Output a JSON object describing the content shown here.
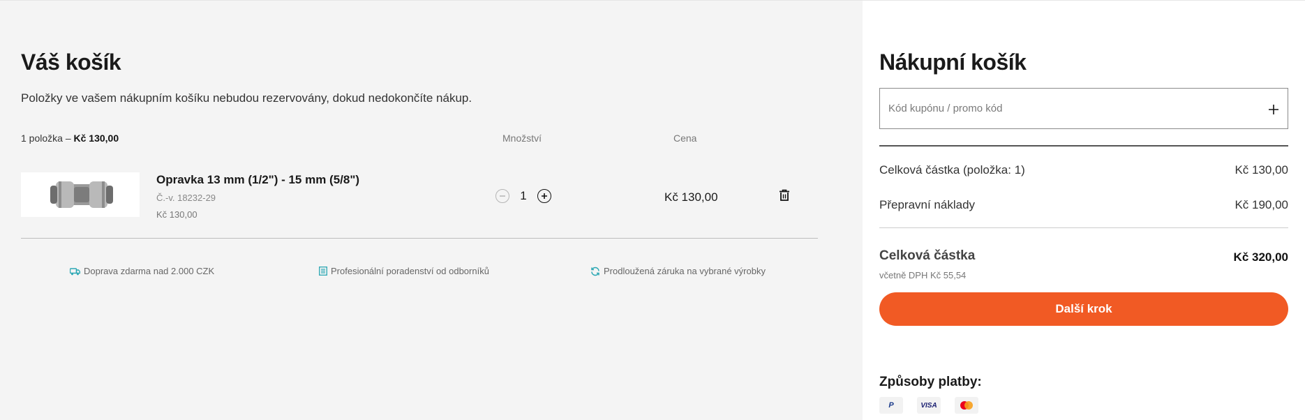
{
  "cart": {
    "title": "Váš košík",
    "note": "Položky ve vašem nákupním košíku nebudou rezervovány, dokud nedokončíte nákup.",
    "summary_prefix": "1 položka – ",
    "summary_total": "Kč 130,00",
    "col_quantity": "Množství",
    "col_price": "Cena"
  },
  "item": {
    "name": "Opravka 13 mm (1/2\") - 15 mm (5/8\")",
    "sku": "Č.-v. 18232-29",
    "unit_price": "Kč 130,00",
    "quantity": "1",
    "line_price": "Kč 130,00",
    "image_icon": "hose-connector-image",
    "delete_icon": "trash-icon"
  },
  "perks": [
    {
      "icon": "truck-icon",
      "label": "Doprava zdarma nad 2.000 CZK"
    },
    {
      "icon": "list-icon",
      "label": "Profesionální poradenství od odborníků"
    },
    {
      "icon": "refresh-icon",
      "label": "Prodloužená záruka na vybrané výrobky"
    }
  ],
  "summary": {
    "title": "Nákupní košík",
    "coupon_placeholder": "Kód kupónu / promo kód",
    "subtotal_label": "Celková částka (položka: 1)",
    "subtotal_value": "Kč 130,00",
    "shipping_label": "Přepravní náklady",
    "shipping_value": "Kč 190,00",
    "total_label": "Celková částka",
    "total_value": "Kč 320,00",
    "vat_note": "včetně DPH Kč 55,54",
    "next_button": "Další krok",
    "payment_title": "Způsoby platby:",
    "payments": [
      {
        "icon": "paypal-icon",
        "label": "P"
      },
      {
        "icon": "visa-icon",
        "label": "VISA"
      },
      {
        "icon": "mastercard-icon",
        "label": ""
      }
    ]
  },
  "colors": {
    "accent": "#f15a24",
    "perk_icon": "#2aa7b3",
    "left_bg": "#f4f4f4"
  }
}
